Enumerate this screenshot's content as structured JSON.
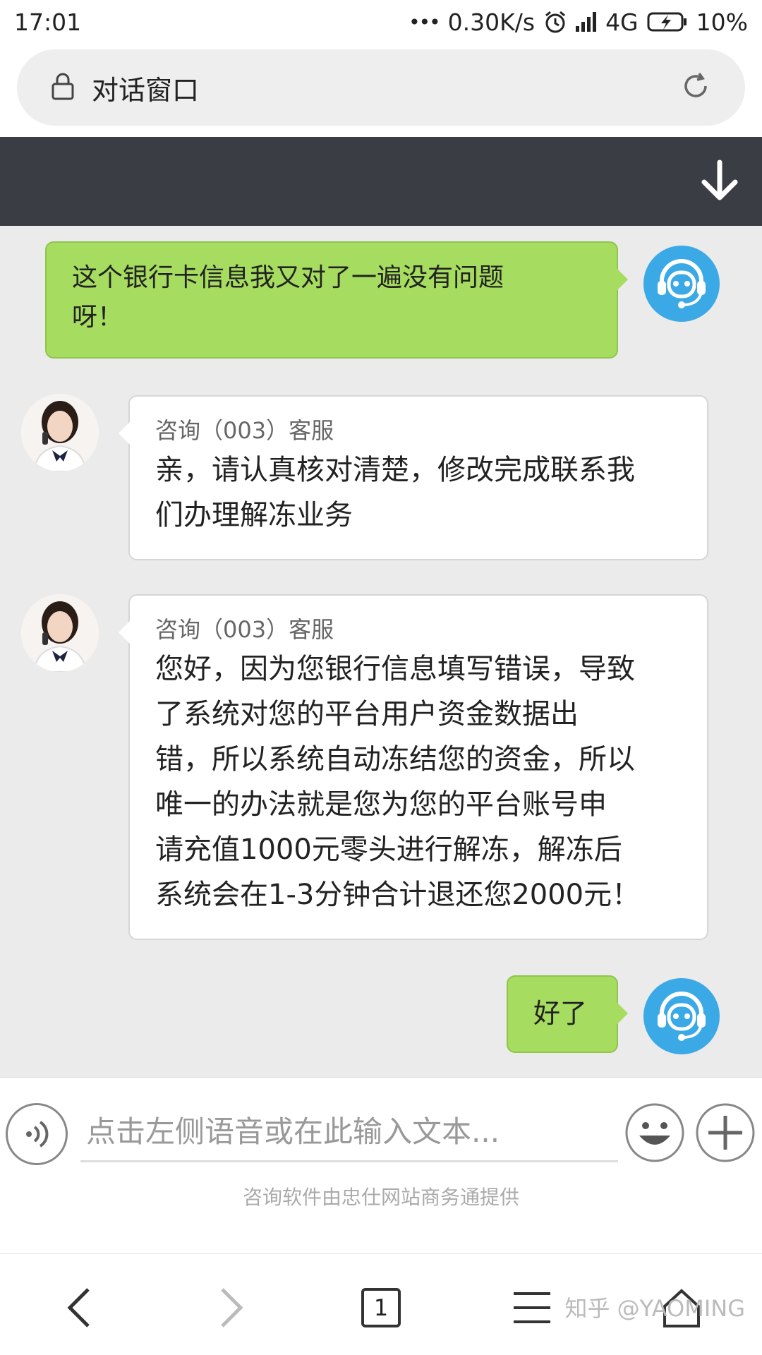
{
  "status_bar": {
    "time": "17:01",
    "dots": "•••",
    "net_speed": "0.30K/s",
    "network": "4G",
    "battery": "10%"
  },
  "url_bar": {
    "title": "对话窗口"
  },
  "messages": [
    {
      "direction": "out",
      "lines": [
        "这个银行卡信息我又对了一遍没有问题",
        "呀！"
      ]
    },
    {
      "direction": "in",
      "sender": "咨询（003）客服",
      "lines": [
        "亲，请认真核对清楚，修改完成联系我",
        "们办理解冻业务"
      ]
    },
    {
      "direction": "in",
      "sender": "咨询（003）客服",
      "lines": [
        "您好，因为您银行信息填写错误，导致",
        "了系统对您的平台用户资金数据出",
        "错，所以系统自动冻结您的资金，所以",
        "唯一的办法就是您为您的平台账号申",
        "请充值1000元零头进行解冻，解冻后",
        "系统会在1-3分钟合计退还您2000元！"
      ]
    },
    {
      "direction": "out",
      "lines": [
        "好了"
      ]
    }
  ],
  "input": {
    "placeholder": "点击左侧语音或在此输入文本..."
  },
  "footer_note": "咨询软件由忠仕网站商务通提供",
  "bottom_nav": {
    "tab_count": "1",
    "watermark": "知乎 @YAOMING"
  },
  "colors": {
    "outgoing_bubble": "#a6dc5f",
    "header_dark": "#3a3d44",
    "chat_bg": "#ebebeb",
    "cs_avatar": "#3aa9e6"
  }
}
